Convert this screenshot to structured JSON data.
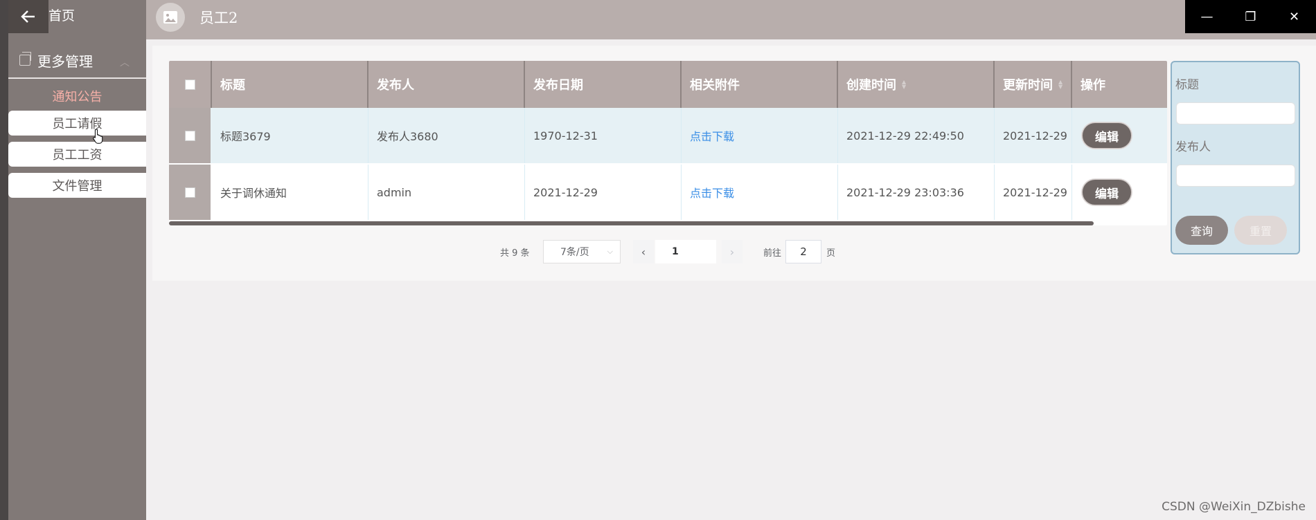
{
  "sidebar": {
    "home_label": "首页",
    "more_label": "更多管理",
    "items": [
      {
        "label": "通知公告"
      },
      {
        "label": "员工请假"
      },
      {
        "label": "员工工资"
      },
      {
        "label": "文件管理"
      }
    ]
  },
  "header": {
    "title": "员工2"
  },
  "table": {
    "columns": [
      "标题",
      "发布人",
      "发布日期",
      "相关附件",
      "创建时间",
      "更新时间",
      "操作"
    ],
    "rows": [
      {
        "title": "标题3679",
        "publisher": "发布人3680",
        "publish_date": "1970-12-31",
        "attachment": "点击下载",
        "created": "2021-12-29 22:49:50",
        "updated": "2021-12-29",
        "action": "编辑"
      },
      {
        "title": "关于调休通知",
        "publisher": "admin",
        "publish_date": "2021-12-29",
        "attachment": "点击下载",
        "created": "2021-12-29 23:03:36",
        "updated": "2021-12-29",
        "action": "编辑"
      }
    ]
  },
  "pagination": {
    "total_text": "共 9 条",
    "page_size": "7条/页",
    "current_page": "1",
    "goto_prefix": "前往",
    "goto_value": "2",
    "goto_suffix": "页"
  },
  "search": {
    "title_label": "标题",
    "publisher_label": "发布人",
    "query_button": "查询",
    "reset_button": "重置"
  },
  "watermark": "CSDN @WeiXin_DZbishe",
  "colors": {
    "sidebar": "#817977",
    "topbar": "#b8aeac",
    "table_header": "#b6aaa8",
    "link": "#3a8ee6",
    "notice_active": "#f7b0a8",
    "search_bg": "#d5e6ee"
  }
}
